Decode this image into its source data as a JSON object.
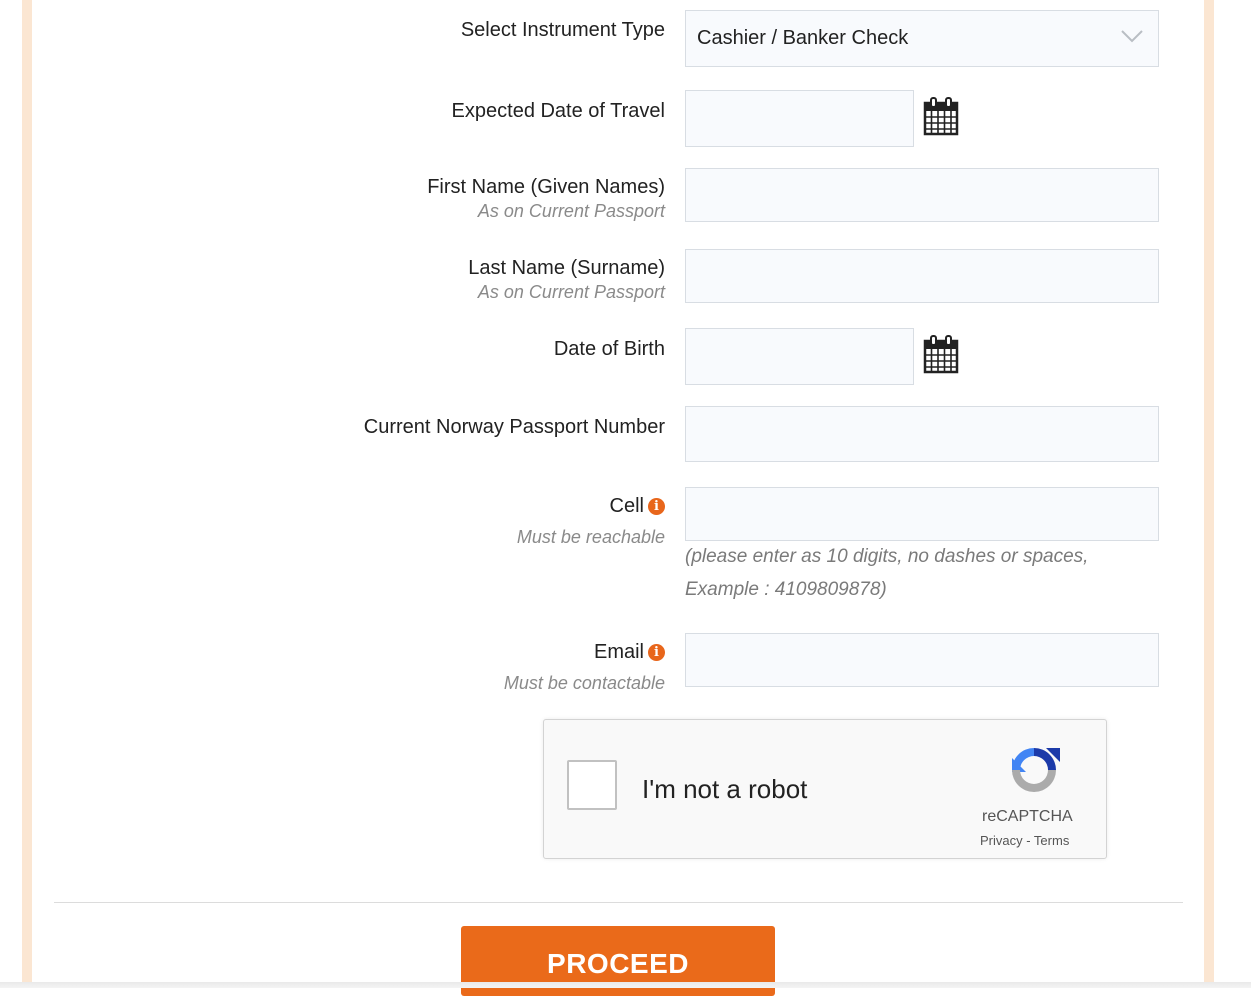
{
  "form": {
    "instrument": {
      "label": "Select Instrument Type",
      "value": "Cashier / Banker Check"
    },
    "travel_date": {
      "label": "Expected Date of Travel",
      "value": ""
    },
    "first_name": {
      "label": "First Name (Given Names)",
      "sub": "As on Current Passport",
      "value": ""
    },
    "last_name": {
      "label": "Last Name (Surname)",
      "sub": "As on Current Passport",
      "value": ""
    },
    "dob": {
      "label": "Date of Birth",
      "value": ""
    },
    "passport": {
      "label": "Current Norway Passport Number",
      "value": ""
    },
    "cell": {
      "label": "Cell",
      "sub": "Must be reachable",
      "value": "",
      "hint_line1": "(please enter as 10 digits, no dashes or spaces,",
      "hint_line2": "Example : 4109809878)"
    },
    "email": {
      "label": "Email",
      "sub": "Must be contactable",
      "value": ""
    }
  },
  "captcha": {
    "label": "I'm not a robot",
    "brand": "reCAPTCHA",
    "links": "Privacy - Terms"
  },
  "proceed_label": "PROCEED",
  "colors": {
    "accent": "#ea6a1a",
    "border_side": "#fbe6d2",
    "field_bg": "#f8fafd"
  },
  "icons": {
    "info": "info-circle-icon",
    "calendar": "calendar-icon",
    "chevron": "chevron-down-icon",
    "recaptcha": "recaptcha-logo-icon"
  }
}
